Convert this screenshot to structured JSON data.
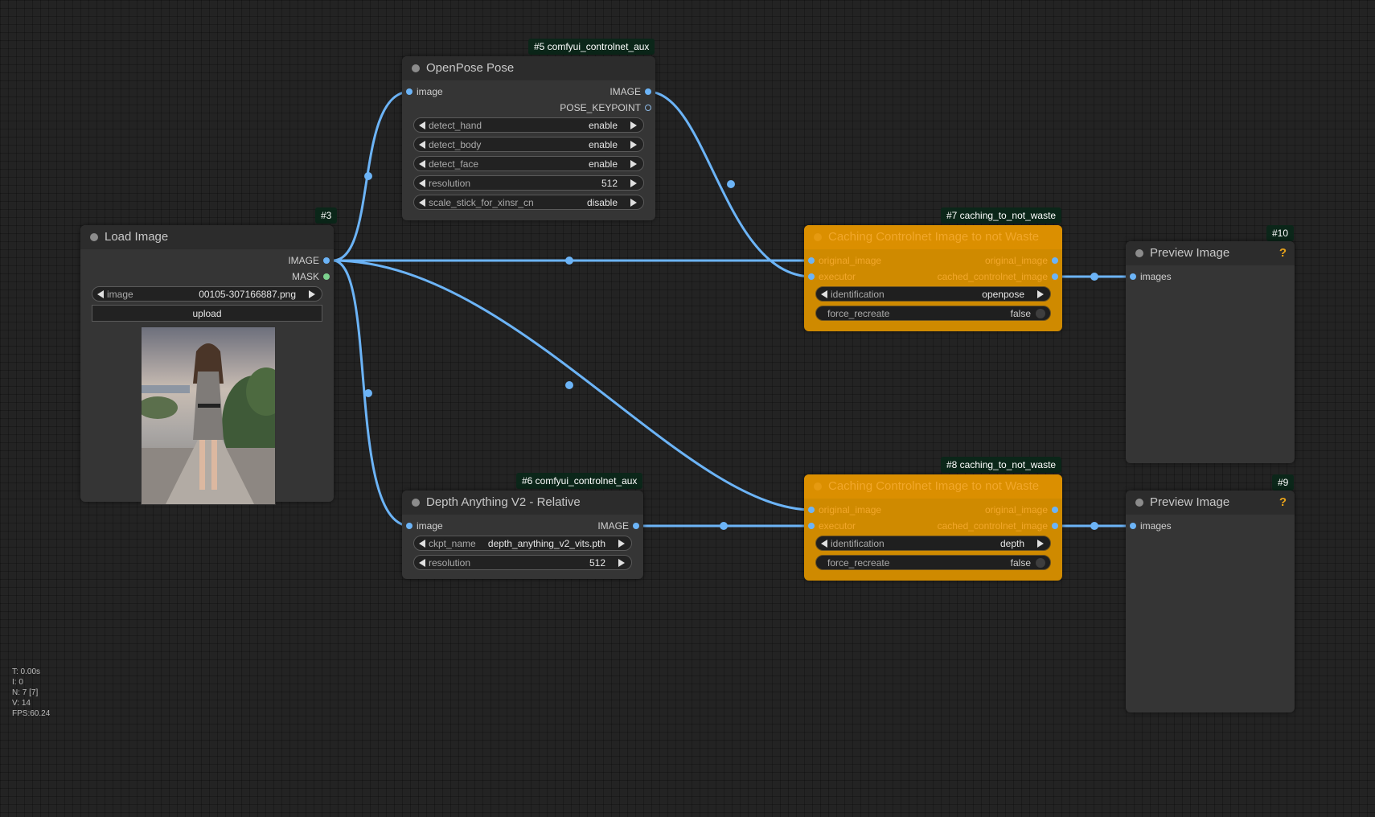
{
  "colors": {
    "link": "#6cb4f7",
    "mask_dot": "#7dd38f",
    "badge_bg": "#0b2619",
    "orange_node": "#cf8a00",
    "node_bg": "#353535",
    "help": "#e8a31a"
  },
  "nodes": {
    "openpose": {
      "badge": "#5 comfyui_controlnet_aux",
      "title": "OpenPose Pose",
      "input_image": "image",
      "outputs": [
        "IMAGE",
        "POSE_KEYPOINT"
      ],
      "widgets": [
        {
          "label": "detect_hand",
          "value": "enable"
        },
        {
          "label": "detect_body",
          "value": "enable"
        },
        {
          "label": "detect_face",
          "value": "enable"
        },
        {
          "label": "resolution",
          "value": "512"
        },
        {
          "label": "scale_stick_for_xinsr_cn",
          "value": "disable"
        }
      ]
    },
    "load_image": {
      "badge": "#3",
      "title": "Load Image",
      "outputs": [
        "IMAGE",
        "MASK"
      ],
      "image_widget": {
        "label": "image",
        "value": "00105-307166887.png"
      },
      "upload_label": "upload"
    },
    "cache7": {
      "badge": "#7 caching_to_not_waste",
      "title": "Caching Controlnet Image to not Waste",
      "inputs": [
        "original_image",
        "executor"
      ],
      "outputs": [
        "original_image",
        "cached_controlnet_image"
      ],
      "identification": {
        "label": "identification",
        "value": "openpose"
      },
      "force_recreate": {
        "label": "force_recreate",
        "value": "false"
      }
    },
    "cache8": {
      "badge": "#8 caching_to_not_waste",
      "title": "Caching Controlnet Image to not Waste",
      "inputs": [
        "original_image",
        "executor"
      ],
      "outputs": [
        "original_image",
        "cached_controlnet_image"
      ],
      "identification": {
        "label": "identification",
        "value": "depth"
      },
      "force_recreate": {
        "label": "force_recreate",
        "value": "false"
      }
    },
    "preview10": {
      "badge": "#10",
      "title": "Preview Image",
      "help": "?",
      "input": "images"
    },
    "preview9": {
      "badge": "#9",
      "title": "Preview Image",
      "help": "?",
      "input": "images"
    },
    "depth": {
      "badge": "#6 comfyui_controlnet_aux",
      "title": "Depth Anything V2 - Relative",
      "input_image": "image",
      "output": "IMAGE",
      "widgets": [
        {
          "label": "ckpt_name",
          "value": "depth_anything_v2_vits.pth"
        },
        {
          "label": "resolution",
          "value": "512"
        }
      ]
    }
  },
  "stats": [
    "T: 0.00s",
    "I: 0",
    "N: 7 [7]",
    "V: 14",
    "FPS:60.24"
  ]
}
